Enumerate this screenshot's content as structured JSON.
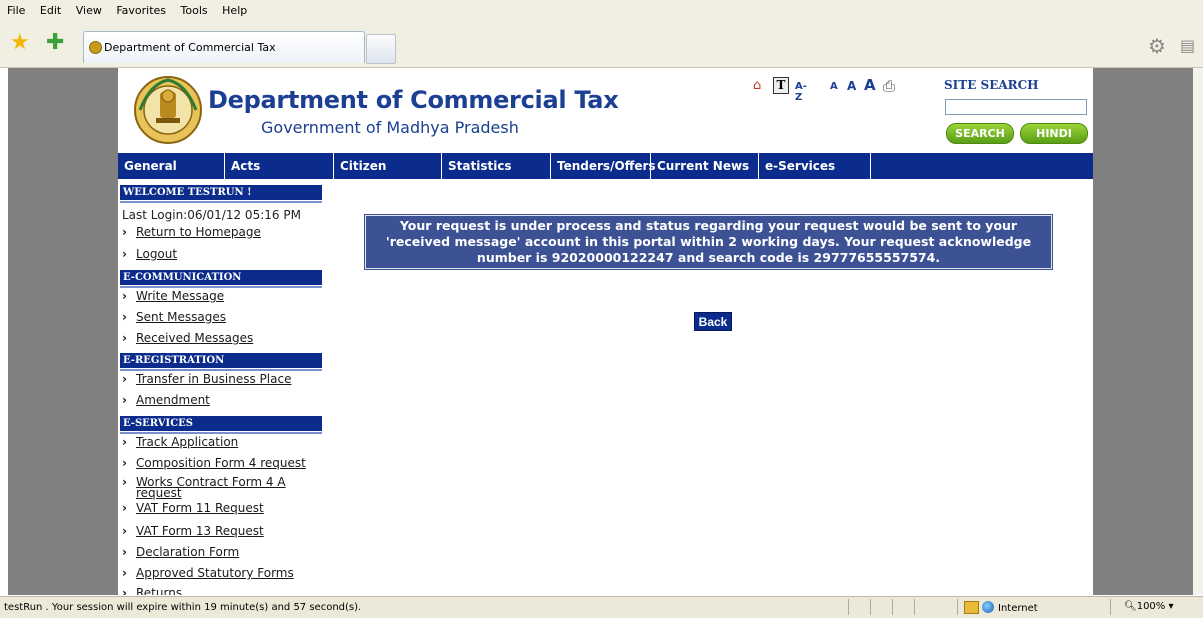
{
  "browser": {
    "menu": [
      "File",
      "Edit",
      "View",
      "Favorites",
      "Tools",
      "Help"
    ],
    "tab_title": "Department of Commercial Tax",
    "icons": [
      "favorites-star-icon",
      "add-favorite-icon",
      "gear-icon",
      "page-icon"
    ]
  },
  "header": {
    "title": "Department of Commercial Tax",
    "subtitle": "Government of Madhya Pradesh",
    "tools": {
      "az": "A-Z",
      "font_small": "A",
      "font_medium": "A",
      "font_large": "A"
    },
    "site_search_label": "SITE SEARCH",
    "search_value": "",
    "search_button": "SEARCH",
    "hindi_button": "HINDI"
  },
  "nav": [
    "General",
    "Acts",
    "Citizen Charter",
    "Statistics",
    "Tenders/Offers",
    "Current News",
    "e-Services"
  ],
  "sidebar": {
    "welcome": "WELCOME TESTRUN !",
    "last_login": "Last Login:06/01/12 05:16 PM",
    "top_links": [
      "Return to Homepage",
      "Logout"
    ],
    "sections": [
      {
        "title": "E-COMMUNICATION",
        "items": [
          "Write Message",
          "Sent Messages",
          "Received Messages"
        ]
      },
      {
        "title": "E-REGISTRATION",
        "items": [
          "Transfer in Business Place",
          "Amendment"
        ]
      },
      {
        "title": "E-SERVICES",
        "items": [
          "Track Application",
          "Composition Form 4 request",
          "Works Contract Form 4 A request",
          "VAT Form 11 Request",
          "VAT Form 13 Request",
          "Declaration Form",
          "Approved Statutory Forms",
          "Returns"
        ]
      }
    ]
  },
  "main": {
    "message_line1": "Your request is under process and status regarding your request would be sent to your",
    "message_line2": "'received message' account in this portal within 2 working days. Your request acknowledge",
    "message_line3": "number is 92020000122247 and search code is 29777655557574.",
    "back_label": "Back"
  },
  "status": {
    "text": "testRun . Your session will expire within 19 minute(s) and 57 second(s).",
    "zone": "Internet",
    "zoom": "100%"
  }
}
